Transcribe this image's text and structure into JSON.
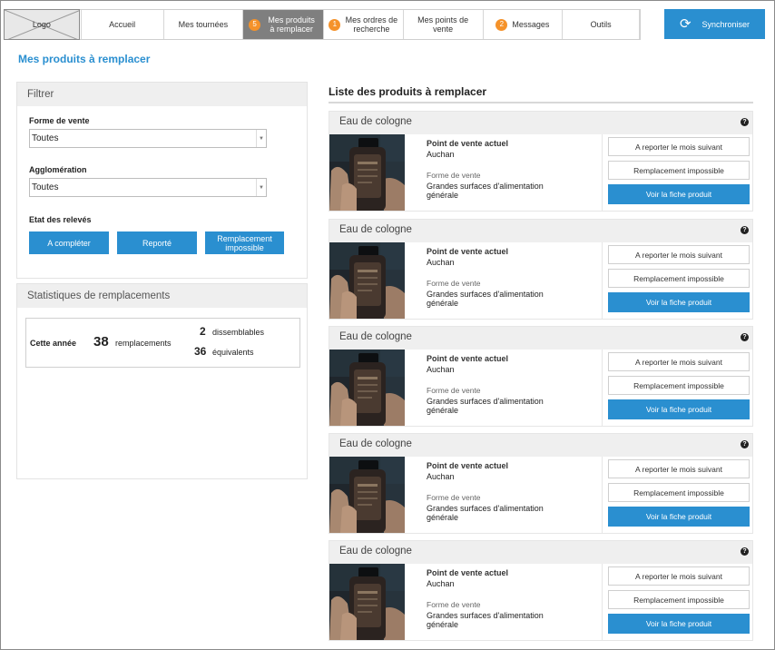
{
  "nav": {
    "logo": "Logo",
    "items": [
      {
        "label": "Accueil",
        "badge": ""
      },
      {
        "label": "Mes tournées",
        "badge": ""
      },
      {
        "label": "Mes produits à remplacer",
        "badge": "5"
      },
      {
        "label": "Mes ordres de recherche",
        "badge": "1"
      },
      {
        "label": "Mes points de vente",
        "badge": ""
      },
      {
        "label": "Messages",
        "badge": "2"
      },
      {
        "label": "Outils",
        "badge": ""
      }
    ],
    "sync_label": "Synchroniser",
    "sync_icon": "sync-icon"
  },
  "page_title": "Mes produits à remplacer",
  "filter": {
    "title": "Filtrer",
    "forme_label": "Forme de vente",
    "forme_value": "Toutes",
    "agglo_label": "Agglomération",
    "agglo_value": "Toutes",
    "etat_label": "Etat des relevés",
    "buttons": [
      "A compléter",
      "Reporté",
      "Remplacement impossible"
    ]
  },
  "stats": {
    "title": "Statistiques de remplacements",
    "period": "Cette année",
    "total": "38",
    "total_label": "remplacements",
    "dissemblables": "2",
    "dissemblables_label": "dissemblables",
    "equivalents": "36",
    "equivalents_label": "équivalents"
  },
  "list": {
    "title": "Liste des produits à remplacer",
    "items": [
      {
        "name": "Eau de cologne",
        "pv_label": "Point de vente actuel",
        "pv": "Auchan",
        "fv_label": "Forme de vente",
        "fv": "Grandes surfaces d'alimentation générale",
        "btn_report": "A reporter le mois suivant",
        "btn_impossible": "Remplacement impossible",
        "btn_fiche": "Voir la fiche produit"
      },
      {
        "name": "Eau de cologne",
        "pv_label": "Point de vente actuel",
        "pv": "Auchan",
        "fv_label": "Forme de vente",
        "fv": "Grandes surfaces d'alimentation générale",
        "btn_report": "A reporter le mois suivant",
        "btn_impossible": "Remplacement impossible",
        "btn_fiche": "Voir la fiche produit"
      },
      {
        "name": "Eau de cologne",
        "pv_label": "Point de vente actuel",
        "pv": "Auchan",
        "fv_label": "Forme de vente",
        "fv": "Grandes surfaces d'alimentation générale",
        "btn_report": "A reporter le mois suivant",
        "btn_impossible": "Remplacement impossible",
        "btn_fiche": "Voir la fiche produit"
      },
      {
        "name": "Eau de cologne",
        "pv_label": "Point de vente actuel",
        "pv": "Auchan",
        "fv_label": "Forme de vente",
        "fv": "Grandes surfaces d'alimentation générale",
        "btn_report": "A reporter le mois suivant",
        "btn_impossible": "Remplacement impossible",
        "btn_fiche": "Voir la fiche produit"
      },
      {
        "name": "Eau de cologne",
        "pv_label": "Point de vente actuel",
        "pv": "Auchan",
        "fv_label": "Forme de vente",
        "fv": "Grandes surfaces d'alimentation générale",
        "btn_report": "A reporter le mois suivant",
        "btn_impossible": "Remplacement impossible",
        "btn_fiche": "Voir la fiche produit"
      }
    ]
  },
  "colors": {
    "accent": "#2a8fd0",
    "badge": "#f5922a",
    "active_tab": "#7f7f7f"
  }
}
